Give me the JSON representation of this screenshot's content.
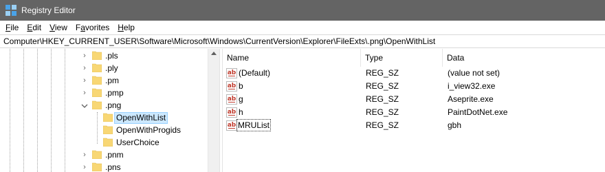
{
  "window": {
    "title": "Registry Editor",
    "icon": "registry-editor-icon",
    "titlebar_color": "#646464"
  },
  "menu": [
    {
      "label": "File",
      "accel": "F",
      "rest": "ile"
    },
    {
      "label": "Edit",
      "accel": "E",
      "rest": "dit"
    },
    {
      "label": "View",
      "accel": "V",
      "rest": "iew"
    },
    {
      "label": "Favorites",
      "accel": "a",
      "pre": "F",
      "rest": "vorites"
    },
    {
      "label": "Help",
      "accel": "H",
      "rest": "elp"
    }
  ],
  "address": "Computer\\HKEY_CURRENT_USER\\Software\\Microsoft\\Windows\\CurrentVersion\\Explorer\\FileExts\\.png\\OpenWithList",
  "tree": {
    "items": [
      {
        "label": ".pls",
        "expanded": false,
        "level": 0
      },
      {
        "label": ".ply",
        "expanded": false,
        "level": 0
      },
      {
        "label": ".pm",
        "expanded": false,
        "level": 0
      },
      {
        "label": ".pmp",
        "expanded": false,
        "level": 0
      },
      {
        "label": ".png",
        "expanded": true,
        "level": 0
      },
      {
        "label": "OpenWithList",
        "expanded": null,
        "level": 1,
        "selected": true
      },
      {
        "label": "OpenWithProgids",
        "expanded": null,
        "level": 1
      },
      {
        "label": "UserChoice",
        "expanded": null,
        "level": 1
      },
      {
        "label": ".pnm",
        "expanded": false,
        "level": 0
      },
      {
        "label": ".pns",
        "expanded": false,
        "level": 0
      }
    ],
    "selection_color": "#cce8ff"
  },
  "list": {
    "columns": {
      "name": "Name",
      "type": "Type",
      "data": "Data"
    },
    "rows": [
      {
        "name": "(Default)",
        "type": "REG_SZ",
        "data": "(value not set)",
        "icon": "string-value-icon"
      },
      {
        "name": "b",
        "type": "REG_SZ",
        "data": "i_view32.exe",
        "icon": "string-value-icon"
      },
      {
        "name": "g",
        "type": "REG_SZ",
        "data": "Aseprite.exe",
        "icon": "string-value-icon"
      },
      {
        "name": "h",
        "type": "REG_SZ",
        "data": "PaintDotNet.exe",
        "icon": "string-value-icon"
      },
      {
        "name": "MRUList",
        "type": "REG_SZ",
        "data": "gbh",
        "icon": "string-value-icon",
        "focused": true
      }
    ],
    "icon_glyph": "ab"
  }
}
